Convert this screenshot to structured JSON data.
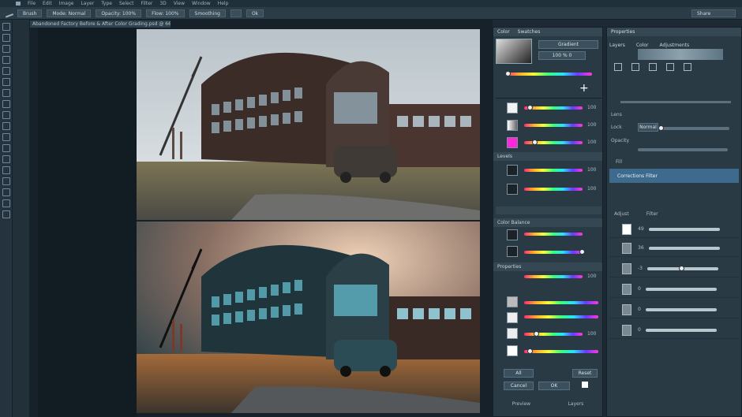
{
  "menubar": {
    "items": [
      "File",
      "Edit",
      "Image",
      "Layer",
      "Type",
      "Select",
      "Filter",
      "3D",
      "View",
      "Window",
      "Help"
    ]
  },
  "options": {
    "chips": [
      "Brush",
      "Mode: Normal",
      "Opacity: 100%",
      "Flow: 100%",
      "Smoothing",
      "",
      "Ok"
    ],
    "right_chip": "Share"
  },
  "document_tab": "Abandoned Factory Before & After Color Grading.psd @ 66% (RGB/8)",
  "color_panel": {
    "tabs": [
      "Color",
      "Swatches"
    ],
    "hex": "Gradient",
    "value": "100 % 0"
  },
  "adjust_panel": {
    "title": "Levels",
    "title2": "Color Balance",
    "title3": "Properties",
    "values": [
      "100",
      "100",
      "100",
      "100",
      "100",
      "100",
      "100",
      "100",
      "100"
    ]
  },
  "layers_panel": {
    "tabs": [
      "Properties",
      "Layers",
      "Color",
      "Adjustments"
    ],
    "rows": [
      "Lens",
      "Lock",
      "Opacity",
      "Fill"
    ],
    "blend": "Normal",
    "layer_name": "Corrections Filter",
    "bottom": [
      "Adjust",
      "Filter"
    ]
  },
  "layers": [
    "49",
    "36",
    "-3",
    "0",
    "0",
    "0"
  ],
  "footer": {
    "left": "Preview",
    "right": "Layers",
    "btn1": "All",
    "btn2": "Reset",
    "btn3": "Cancel",
    "btn4": "OK"
  },
  "accent": "#3e6a8d"
}
